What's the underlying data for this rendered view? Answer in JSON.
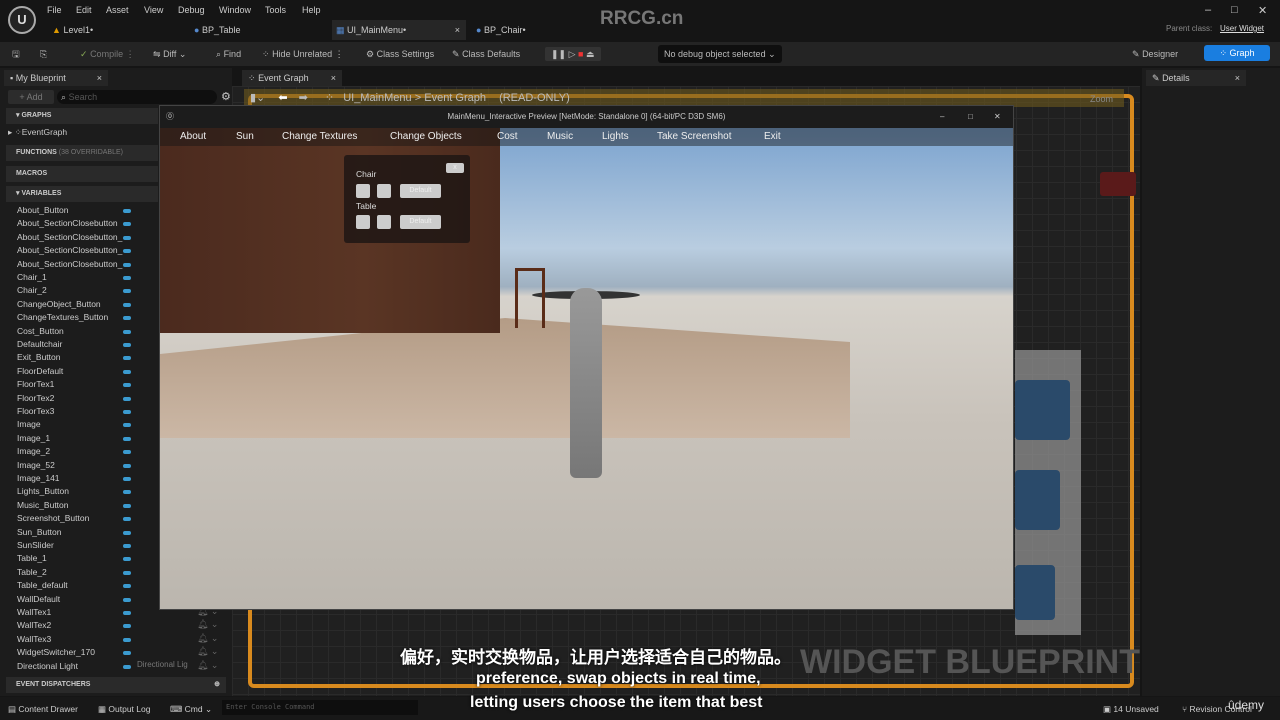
{
  "menu": [
    "File",
    "Edit",
    "Asset",
    "View",
    "Debug",
    "Window",
    "Tools",
    "Help"
  ],
  "tabs": [
    {
      "label": "Level1•"
    },
    {
      "label": "BP_Table"
    },
    {
      "label": "UI_MainMenu•"
    },
    {
      "label": "BP_Chair•"
    }
  ],
  "watermark": "RRCG.cn",
  "parent_class_label": "Parent class:",
  "parent_class": "User Widget",
  "toolbar": {
    "compile": "Compile",
    "diff": "Diff",
    "find": "Find",
    "hide_unrelated": "Hide Unrelated",
    "class_settings": "Class Settings",
    "class_defaults": "Class Defaults",
    "debug_object": "No debug object selected",
    "designer": "Designer",
    "graph": "Graph"
  },
  "my_blueprint": {
    "tab": "My Blueprint",
    "add": "+ Add",
    "search_placeholder": "Search",
    "graphs": "GRAPHS",
    "event_graph": "EventGraph",
    "functions": "FUNCTIONS",
    "functions_count": "(38 OVERRIDABLE)",
    "macros": "MACROS",
    "variables": "VARIABLES",
    "variable_items": [
      "About_Button",
      "About_SectionClosebutton",
      "About_SectionClosebutton_",
      "About_SectionClosebutton_",
      "About_SectionClosebutton_",
      "Chair_1",
      "Chair_2",
      "ChangeObject_Button",
      "ChangeTextures_Button",
      "Cost_Button",
      "Defaultchair",
      "Exit_Button",
      "FloorDefault",
      "FloorTex1",
      "FloorTex2",
      "FloorTex3",
      "Image",
      "Image_1",
      "Image_2",
      "Image_52",
      "Image_141",
      "Lights_Button",
      "Music_Button",
      "Screenshot_Button",
      "Sun_Button",
      "SunSlider",
      "Table_1",
      "Table_2",
      "Table_default",
      "WallDefault",
      "WallTex1",
      "WallTex2",
      "WallTex3",
      "WidgetSwitcher_170",
      "Directional Light"
    ],
    "directional_light_type": "Directional Lig",
    "event_dispatchers": "EVENT DISPATCHERS"
  },
  "graph": {
    "tab": "Event Graph",
    "breadcrumb_root": "UI_MainMenu",
    "breadcrumb_sep": ">",
    "breadcrumb_leaf": "Event Graph",
    "readonly": "(READ-ONLY)",
    "zoom": "Zoom",
    "watermark_text": "WIDGET BLUEPRINT"
  },
  "details": {
    "tab": "Details"
  },
  "preview": {
    "title": "MainMenu_Interactive Preview [NetMode: Standalone 0]  (64-bit/PC D3D SM6)",
    "nav": [
      "About",
      "Sun",
      "Change Textures",
      "Change Objects",
      "Cost",
      "Music",
      "Lights",
      "Take Screenshot",
      "Exit"
    ],
    "panel": {
      "close": "x",
      "chair": "Chair",
      "table": "Table",
      "default": "Default"
    }
  },
  "subtitles": {
    "zh": "偏好，实时交换物品，让用户选择适合自己的物品。",
    "en1": "preference, swap objects in real time,",
    "en2": "letting users choose the item that best"
  },
  "status": {
    "content_drawer": "Content Drawer",
    "output_log": "Output Log",
    "cmd": "Cmd",
    "console_placeholder": "Enter Console Command",
    "unsaved": "14 Unsaved",
    "revision": "Revision Control",
    "udemy": "ûdemy"
  }
}
